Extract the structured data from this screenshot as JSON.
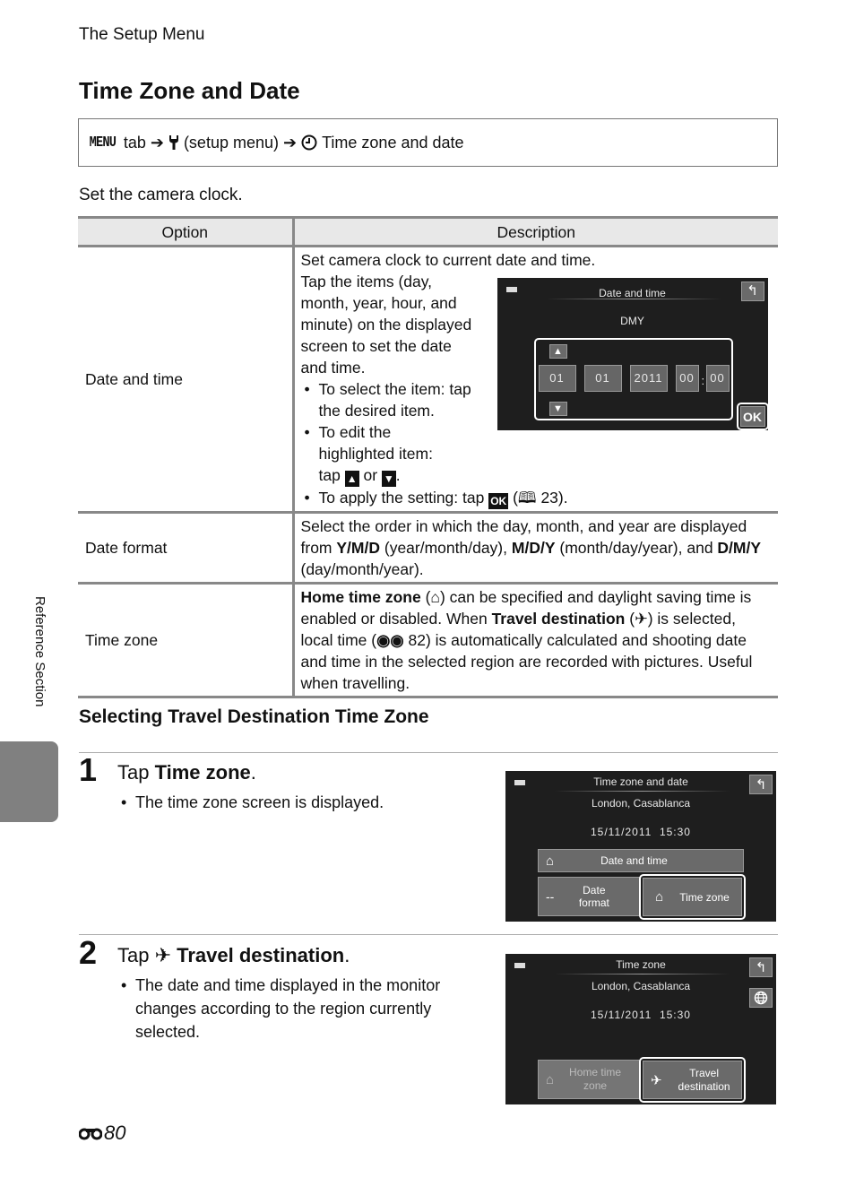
{
  "running_head": "The Setup Menu",
  "title": "Time Zone and Date",
  "nav_path": {
    "menu_label": "MENU",
    "tab_word": "tab",
    "setup_menu": "(setup menu)",
    "item": "Time zone and date"
  },
  "intro": "Set the camera clock.",
  "table": {
    "headers": [
      "Option",
      "Description"
    ],
    "rows": [
      {
        "option": "Date and time",
        "lead": "Set camera clock to current date and time.",
        "para": "Tap the items (day, month, year, hour, and minute) on the displayed screen to set the date and time.",
        "bullet1": "To select the item: tap the desired item.",
        "bullet2_pre": "To edit the highlighted item: tap",
        "bullet2_or": "or",
        "bullet3_pre": "To apply the setting: tap",
        "bullet3_ref": "23)."
      },
      {
        "option": "Date format",
        "t1": "Select the order in which the day, month, and year are displayed from ",
        "b1": "Y/M/D",
        "t2": " (year/month/day), ",
        "b2": "M/D/Y",
        "t3": " (month/day/year), and ",
        "b3": "D/M/Y",
        "t4": " (day/month/year)."
      },
      {
        "option": "Time zone",
        "b1": "Home time zone",
        "t1": ") can be specified and daylight saving time is enabled or disabled. When ",
        "b2": "Travel destination",
        "t2": ") is selected, local time (",
        "t3": " 82) is automatically calculated and shooting date and time in the selected region are recorded with pictures. Useful when travelling."
      }
    ]
  },
  "screen_date_time": {
    "title": "Date and time",
    "format": "DMY",
    "day": "01",
    "month": "01",
    "year": "2011",
    "hour": "00",
    "minute": "00",
    "ok": "OK"
  },
  "section_heading": "Selecting Travel Destination Time Zone",
  "steps": [
    {
      "number": "1",
      "pre": "Tap ",
      "bold": "Time zone",
      "post": ".",
      "bullet": "The time zone screen is displayed.",
      "screen": {
        "title": "Time zone and date",
        "city": "London, Casablanca",
        "datetime": "15/11/2011  15:30",
        "btn_date_time": "Date and time",
        "btn_date_format": "Date format",
        "btn_time_zone": "Time zone",
        "dash": "--"
      }
    },
    {
      "number": "2",
      "pre": "Tap ",
      "bold": "Travel destination",
      "post": ".",
      "bullet": "The date and time displayed in the monitor changes according to the region currently selected.",
      "screen": {
        "title": "Time zone",
        "city": "London, Casablanca",
        "datetime": "15/11/2011  15:30",
        "btn_home": "Home time zone",
        "btn_travel": "Travel destination"
      }
    }
  ],
  "side_label": "Reference Section",
  "page_number": "80"
}
